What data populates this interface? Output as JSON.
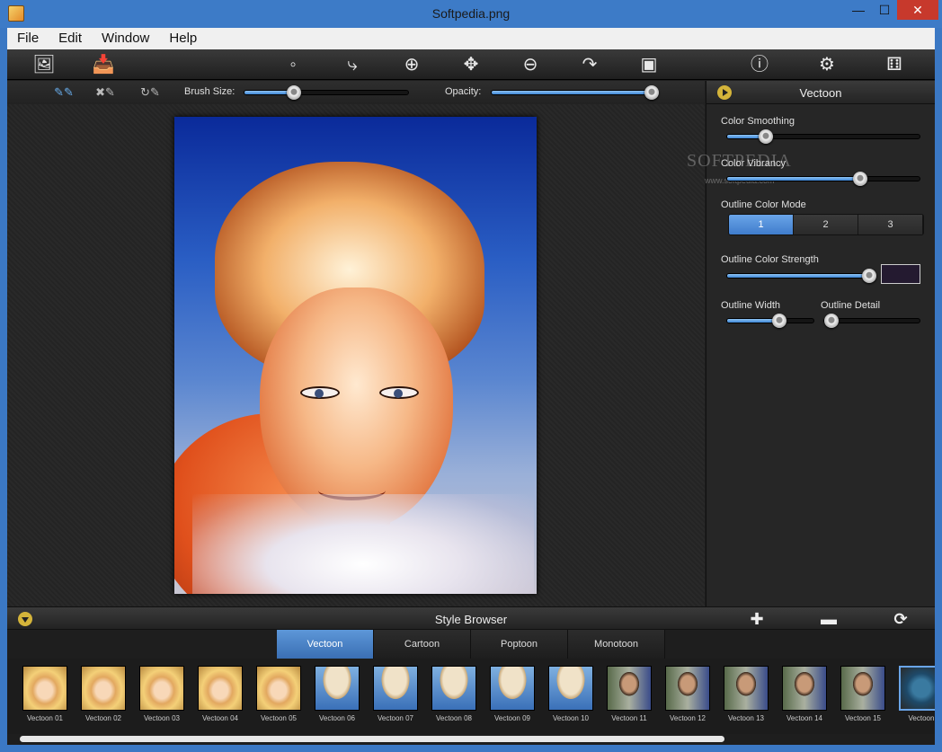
{
  "window": {
    "title": "Softpedia.png"
  },
  "menu": [
    "File",
    "Edit",
    "Window",
    "Help"
  ],
  "toolbar": {
    "icons": [
      "open-image-icon",
      "save-icon",
      "crop-icon",
      "brush-icon",
      "zoom-in-icon",
      "move-icon",
      "zoom-out-icon",
      "redo-icon",
      "fit-image-icon",
      "info-icon",
      "settings-icon",
      "dice-icon"
    ]
  },
  "brushbar": {
    "brush_size_label": "Brush Size:",
    "brush_size": 0.3,
    "opacity_label": "Opacity:",
    "opacity": 1.0
  },
  "panel": {
    "title": "Vectoon",
    "color_smoothing_label": "Color Smoothing",
    "color_smoothing": 0.2,
    "color_vibrancy_label": "Color Vibrancy",
    "color_vibrancy": 0.69,
    "outline_color_mode_label": "Outline Color Mode",
    "outline_color_modes": [
      "1",
      "2",
      "3"
    ],
    "outline_color_mode_selected": "1",
    "outline_color_strength_label": "Outline Color Strength",
    "outline_color_strength": 1.0,
    "outline_color": "#241a30",
    "outline_width_label": "Outline Width",
    "outline_width": 0.6,
    "outline_detail_label": "Outline Detail",
    "outline_detail": 0.08,
    "watermark": "SOFTPEDIA",
    "watermark_url": "www.softpedia.com"
  },
  "style_browser": {
    "title": "Style Browser",
    "tabs": [
      "Vectoon",
      "Cartoon",
      "Poptoon",
      "Monotoon"
    ],
    "active_tab": "Vectoon",
    "thumbnails": [
      "Vectoon 01",
      "Vectoon 02",
      "Vectoon 03",
      "Vectoon 04",
      "Vectoon 05",
      "Vectoon 06",
      "Vectoon 07",
      "Vectoon 08",
      "Vectoon 09",
      "Vectoon 10",
      "Vectoon 11",
      "Vectoon 12",
      "Vectoon 13",
      "Vectoon 14",
      "Vectoon 15",
      "Vectoon"
    ]
  }
}
